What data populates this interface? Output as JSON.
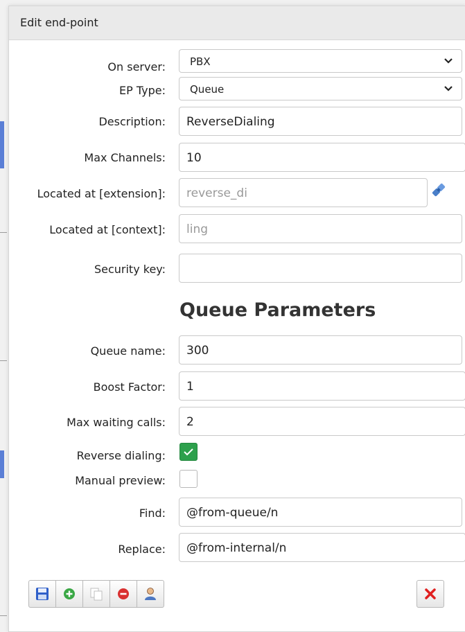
{
  "dialog": {
    "title": "Edit end-point"
  },
  "form": {
    "on_server": {
      "label": "On server:",
      "value": "PBX"
    },
    "ep_type": {
      "label": "EP Type:",
      "value": "Queue"
    },
    "description": {
      "label": "Description:",
      "value": "ReverseDialing"
    },
    "max_channels": {
      "label": "Max Channels:",
      "value": "10"
    },
    "located_extension": {
      "label": "Located at [extension]:",
      "value": "reverse_di"
    },
    "located_context": {
      "label": "Located at [context]:",
      "value": "ling"
    },
    "security_key": {
      "label": "Security key:",
      "value": ""
    }
  },
  "queue": {
    "section_title": "Queue Parameters",
    "queue_name": {
      "label": "Queue name:",
      "value": "300"
    },
    "boost_factor": {
      "label": "Boost Factor:",
      "value": "1"
    },
    "max_waiting_calls": {
      "label": "Max waiting calls:",
      "value": "2"
    },
    "reverse_dialing": {
      "label": "Reverse dialing:",
      "checked": true
    },
    "manual_preview": {
      "label": "Manual preview:",
      "checked": false
    },
    "find": {
      "label": "Find:",
      "value": "@from-queue/n"
    },
    "replace": {
      "label": "Replace:",
      "value": "@from-internal/n"
    }
  },
  "toolbar": {
    "icons": [
      "save-icon",
      "add-icon",
      "copy-icon",
      "delete-icon",
      "user-icon"
    ],
    "close_icon": "close-icon"
  },
  "colors": {
    "checkbox_checked": "#2da04c",
    "delete_red": "#d93030",
    "add_green": "#3aa845",
    "save_blue": "#2f5fc9"
  }
}
